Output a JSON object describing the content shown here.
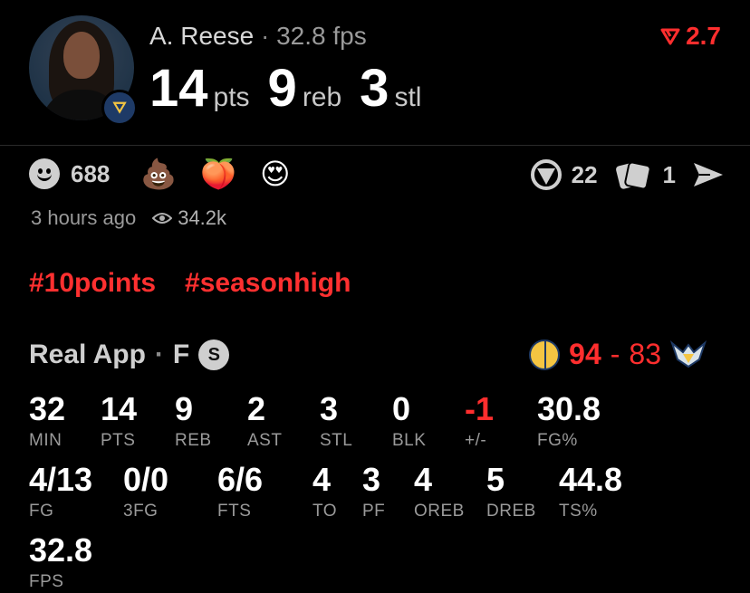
{
  "player": {
    "name": "A. Reese",
    "fps_label": "32.8 fps",
    "stats": [
      {
        "value": "14",
        "unit": "pts"
      },
      {
        "value": "9",
        "unit": "reb"
      },
      {
        "value": "3",
        "unit": "stl"
      }
    ]
  },
  "rating": {
    "value": "2.7",
    "color": "#ff2e2e",
    "icon": "down-arrow-icon"
  },
  "reactions": {
    "smile_count": "688",
    "emojis": [
      "💩",
      "🍑",
      "😍"
    ],
    "comments_count": "22",
    "cards_count": "1"
  },
  "meta": {
    "time": "3 hours ago",
    "views": "34.2k"
  },
  "tags": [
    "#10points",
    "#seasonhigh"
  ],
  "game": {
    "source": "Real App",
    "separator": "·",
    "position": "F",
    "badge": "S",
    "home_score": "94",
    "away_score": "83",
    "score_color": "#ff2e2e"
  },
  "box_score": {
    "row1": [
      {
        "value": "32",
        "label": "MIN"
      },
      {
        "value": "14",
        "label": "PTS"
      },
      {
        "value": "9",
        "label": "REB"
      },
      {
        "value": "2",
        "label": "AST"
      },
      {
        "value": "3",
        "label": "STL"
      },
      {
        "value": "0",
        "label": "BLK"
      },
      {
        "value": "-1",
        "label": "+/-"
      },
      {
        "value": "30.8",
        "label": "FG%"
      }
    ],
    "row2": [
      {
        "value": "4/13",
        "label": "FG"
      },
      {
        "value": "0/0",
        "label": "3FG"
      },
      {
        "value": "6/6",
        "label": "FTS"
      },
      {
        "value": "4",
        "label": "TO"
      },
      {
        "value": "3",
        "label": "PF"
      },
      {
        "value": "4",
        "label": "OREB"
      },
      {
        "value": "5",
        "label": "DREB"
      },
      {
        "value": "44.8",
        "label": "TS%"
      }
    ],
    "row3": [
      {
        "value": "32.8",
        "label": "FPS"
      }
    ]
  }
}
